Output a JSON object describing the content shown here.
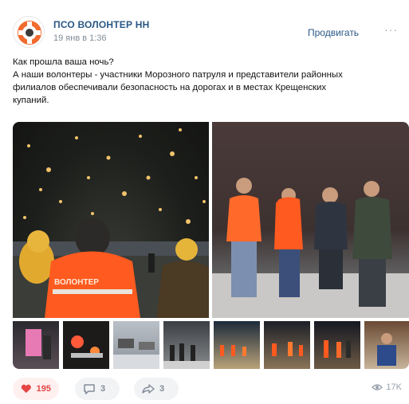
{
  "post": {
    "author": "ПСО ВОЛОНТЕР НН",
    "date": "19 янв в 1:36",
    "promote_label": "Продвигать",
    "more_label": "···",
    "text_lines": [
      "Как прошла ваша ночь?",
      "А наши волонтеры - участники Морозного патруля и представители районных",
      "филиалов обеспечивали безопасность на дорогах и в местах Крещенских",
      "купаний."
    ],
    "vest_text": "ВОЛОНТЕР"
  },
  "actions": {
    "likes": "195",
    "comments": "3",
    "shares": "3",
    "views": "17K"
  },
  "colors": {
    "accent": "#2a5885",
    "like": "#e64646",
    "vest": "#ff5a1f"
  },
  "icons": {
    "like": "heart-icon",
    "comment": "comment-icon",
    "share": "share-icon",
    "views": "eye-icon",
    "more": "more-dots-icon"
  }
}
